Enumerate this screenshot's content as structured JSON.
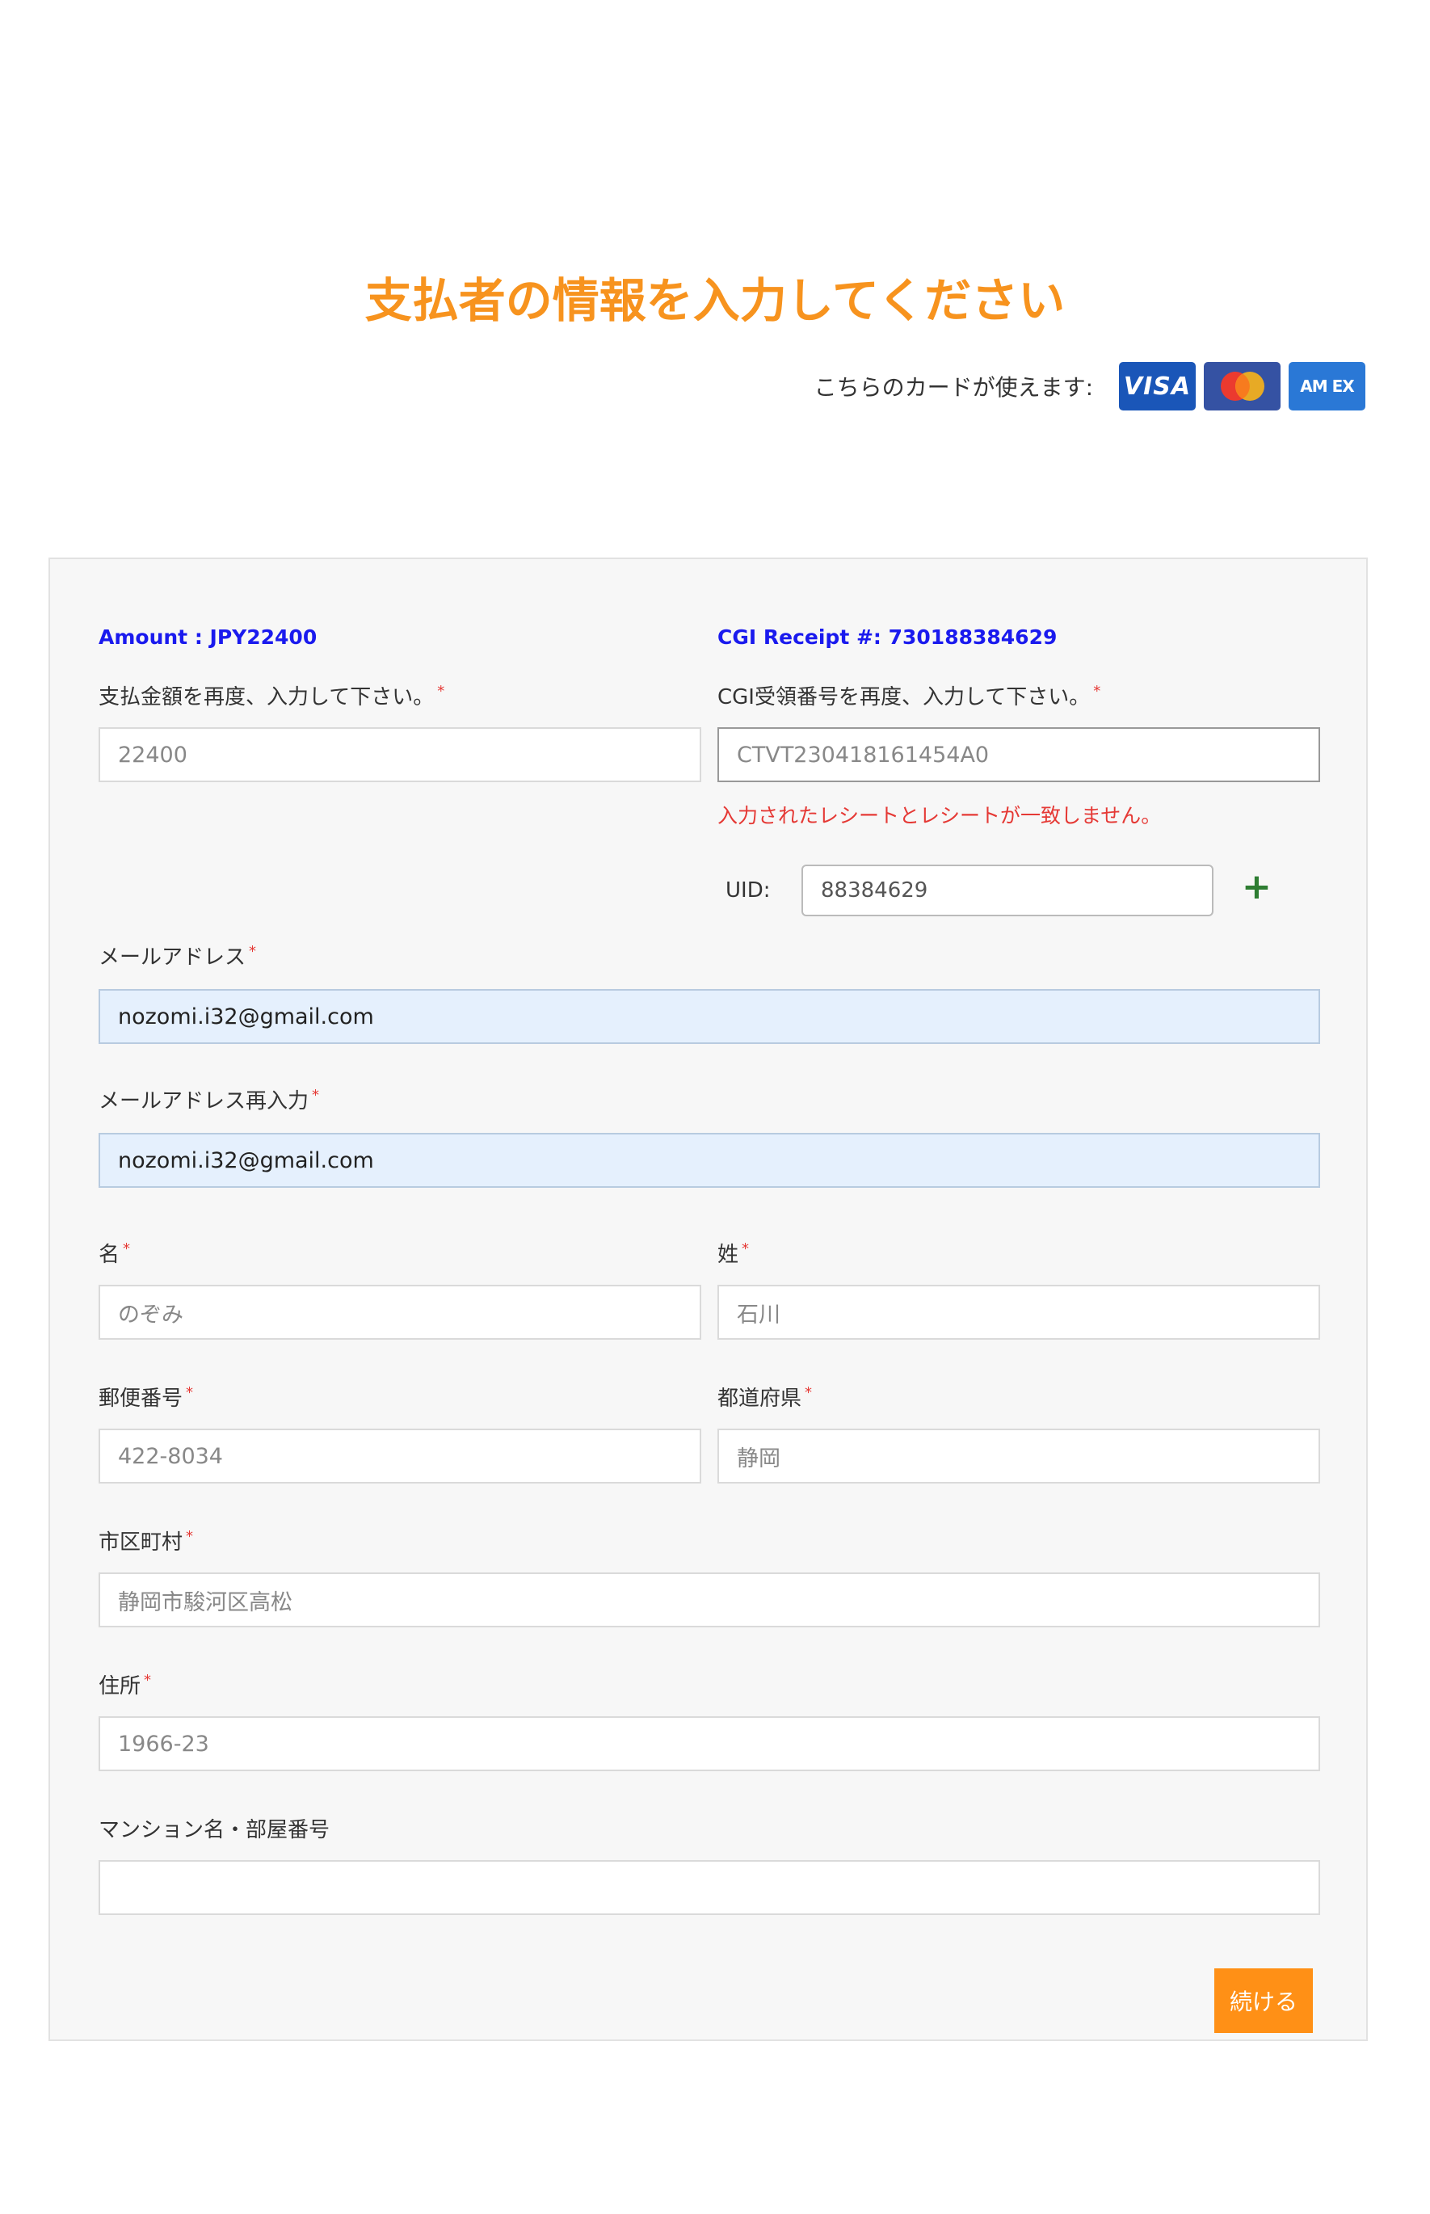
{
  "header": {
    "title": "支払者の情報を入力してください",
    "cards_label": "こちらのカードが使えます:",
    "cards": [
      {
        "name": "visa-icon",
        "text": "VISA"
      },
      {
        "name": "mastercard-icon",
        "text": ""
      },
      {
        "name": "amex-icon",
        "text": "AM EX"
      }
    ]
  },
  "form": {
    "amount_info": "Amount : JPY22400",
    "receipt_info": "CGI Receipt #: 730188384629",
    "amount_label": "支払金額を再度、入力して下さい。",
    "amount_value": "22400",
    "receipt_label": "CGI受領番号を再度、入力して下さい。",
    "receipt_value": "CTVT230418161454A0",
    "receipt_error": "入力されたレシートとレシートが一致しません。",
    "uid_label": "UID:",
    "uid_value": "88384629",
    "email_label": "メールアドレス",
    "email_value": "nozomi.i32@gmail.com",
    "email_confirm_label": "メールアドレス再入力",
    "email_confirm_value": "nozomi.i32@gmail.com",
    "first_name_label": "名",
    "first_name_placeholder": "のぞみ",
    "last_name_label": "姓",
    "last_name_placeholder": "石川",
    "postal_label": "郵便番号",
    "postal_placeholder": "422-8034",
    "prefecture_label": "都道府県",
    "prefecture_placeholder": "静岡",
    "city_label": "市区町村",
    "city_placeholder": "静岡市駿河区高松",
    "address_label": "住所",
    "address_placeholder": "1966-23",
    "building_label": "マンション名・部屋番号",
    "building_value": "",
    "required_mark": "*",
    "submit_label": "続ける"
  },
  "colors": {
    "accent": "#f7931e",
    "info": "#1a1aee",
    "error": "#e53935",
    "plus": "#2e7d32",
    "button": "#ff9016"
  }
}
